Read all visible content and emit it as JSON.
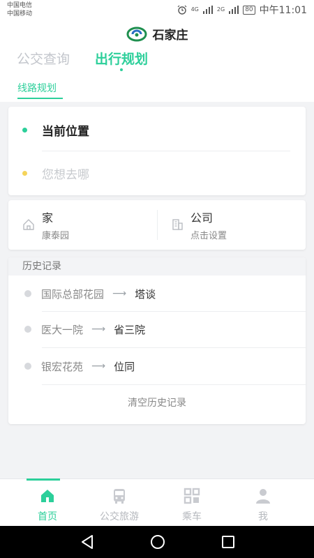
{
  "status_bar": {
    "carrier_1": "中国电信",
    "carrier_2": "中国移动",
    "signal_1": "4G",
    "signal_2": "2G",
    "battery": "80",
    "time": "中午11:01"
  },
  "header": {
    "app_title": "石家庄",
    "tabs": [
      {
        "label": "公交查询",
        "active": false
      },
      {
        "label": "出行规划",
        "active": true
      }
    ],
    "subtab": "线路规划"
  },
  "route": {
    "from_label": "当前位置",
    "to_placeholder": "您想去哪"
  },
  "favorites": {
    "home": {
      "title": "家",
      "subtitle": "康泰园"
    },
    "company": {
      "title": "公司",
      "subtitle": "点击设置"
    }
  },
  "history": {
    "header": "历史记录",
    "items": [
      {
        "from": "国际总部花园",
        "to": "塔谈"
      },
      {
        "from": "医大一院",
        "to": "省三院"
      },
      {
        "from": "银宏花苑",
        "to": "位同"
      }
    ],
    "clear_label": "清空历史记录"
  },
  "bottom_nav": {
    "items": [
      {
        "label": "首页",
        "icon": "home-icon",
        "active": true
      },
      {
        "label": "公交旅游",
        "icon": "bus-icon",
        "active": false
      },
      {
        "label": "乘车",
        "icon": "qr-grid-icon",
        "active": false
      },
      {
        "label": "我",
        "icon": "user-icon",
        "active": false
      }
    ]
  },
  "colors": {
    "accent": "#2ccf9a",
    "from_dot": "#2ccf9a",
    "to_dot": "#f5d45a",
    "background": "#f2f3f5"
  }
}
